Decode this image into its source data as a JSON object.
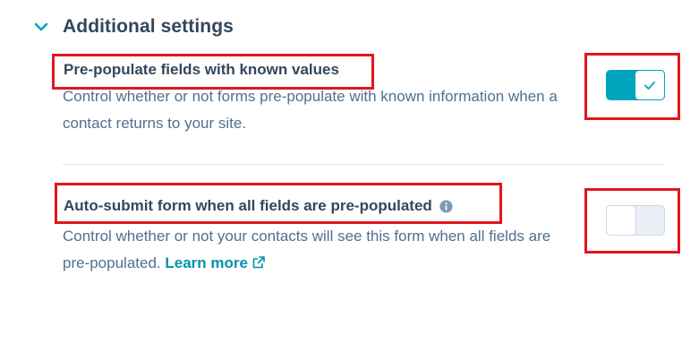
{
  "section": {
    "title": "Additional settings",
    "expanded": true
  },
  "settings": [
    {
      "title": "Pre-populate fields with known values",
      "description": "Control whether or not forms pre-populate with known information when a contact returns to your site.",
      "enabled": true
    },
    {
      "title": "Auto-submit form when all fields are pre-populated",
      "description": "Control whether or not your contacts will see this form when all fields are pre-populated.",
      "link_label": "Learn more",
      "enabled": false
    }
  ],
  "colors": {
    "accent": "#00a4bd",
    "link": "#0091ae",
    "annotation": "#e0161e"
  },
  "icons": {
    "section_chevron": "chevron-down-icon",
    "toggle_on": "checkmark-icon",
    "info": "info-icon",
    "external_link": "external-link-icon"
  }
}
